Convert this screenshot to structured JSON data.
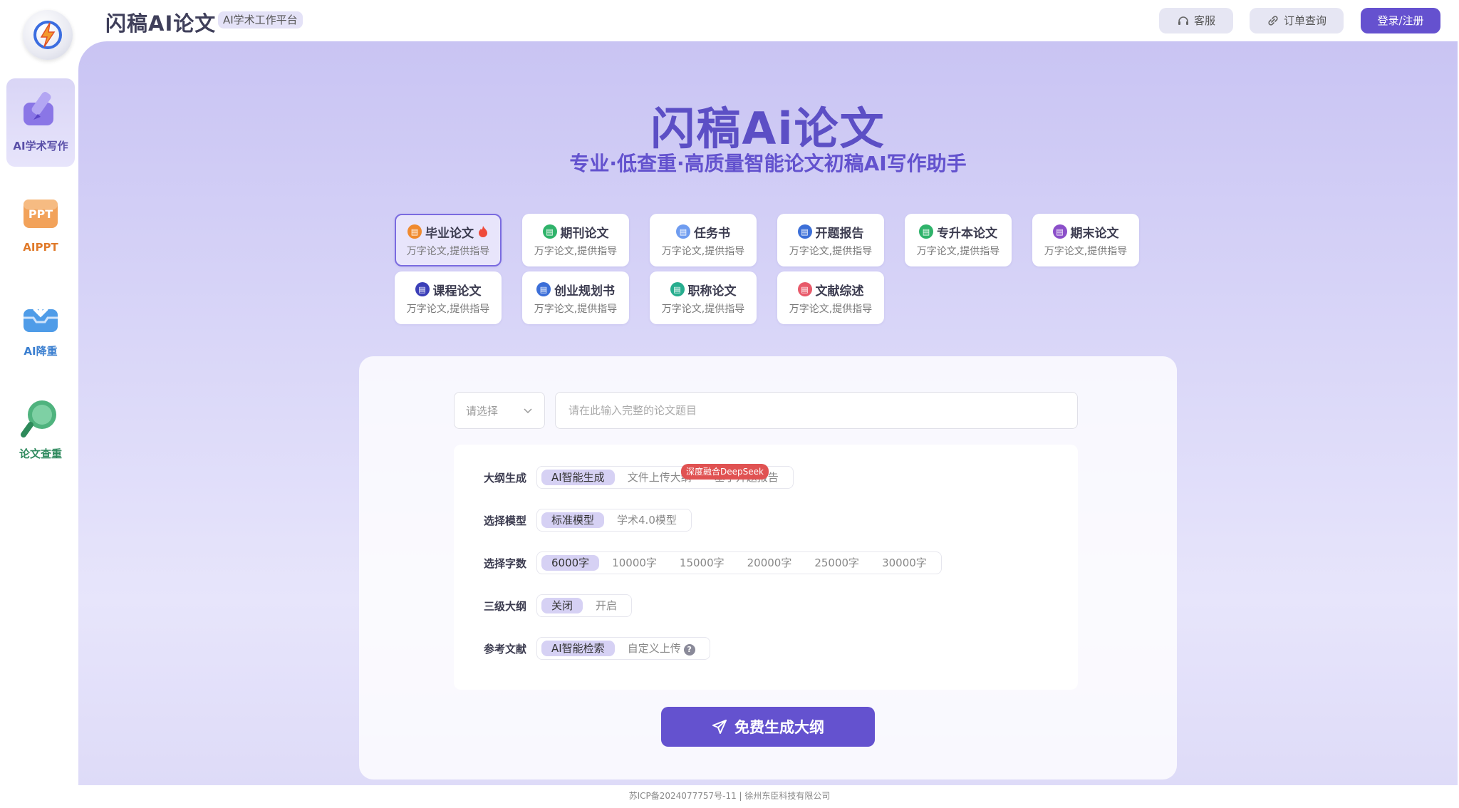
{
  "header": {
    "title": "闪稿AI论文",
    "tag": "AI学术工作平台",
    "service_label": "客服",
    "order_label": "订单查询",
    "login_label": "登录/注册"
  },
  "sidebar": {
    "items": [
      {
        "label": "AI学术写作",
        "icon": "pen-writing-icon",
        "active": true
      },
      {
        "label": "AIPPT",
        "icon": "ppt-icon"
      },
      {
        "label": "AI降重",
        "icon": "inbox-download-icon"
      },
      {
        "label": "论文查重",
        "icon": "search-magnifier-icon"
      }
    ]
  },
  "hero": {
    "title": "闪稿Ai论文",
    "subtitle": "专业·低查重·高质量智能论文初稿AI写作助手"
  },
  "categories": [
    {
      "name": "毕业论文",
      "desc": "万字论文,提供指导",
      "color": "#f08a2e",
      "active": true
    },
    {
      "name": "期刊论文",
      "desc": "万字论文,提供指导",
      "color": "#2fb36a"
    },
    {
      "name": "任务书",
      "desc": "万字论文,提供指导",
      "color": "#6f9cf0"
    },
    {
      "name": "开题报告",
      "desc": "万字论文,提供指导",
      "color": "#3c6fd8"
    },
    {
      "name": "专升本论文",
      "desc": "万字论文,提供指导",
      "color": "#2fb36a"
    },
    {
      "name": "期末论文",
      "desc": "万字论文,提供指导",
      "color": "#8b4fc9"
    },
    {
      "name": "课程论文",
      "desc": "万字论文,提供指导",
      "color": "#3b3fb8"
    },
    {
      "name": "创业规划书",
      "desc": "万字论文,提供指导",
      "color": "#3c6fd8"
    },
    {
      "name": "职称论文",
      "desc": "万字论文,提供指导",
      "color": "#27ad8e"
    },
    {
      "name": "文献综述",
      "desc": "万字论文,提供指导",
      "color": "#e85a6a"
    }
  ],
  "form": {
    "select_placeholder": "请选择",
    "topic_placeholder": "请在此输入完整的论文题目",
    "outline": {
      "label": "大纲生成",
      "options": [
        "AI智能生成",
        "文件上传大纲",
        "基于开题报告"
      ]
    },
    "model": {
      "label": "选择模型",
      "options": [
        "标准模型",
        "学术4.0模型"
      ],
      "badge": "深度融合DeepSeek"
    },
    "words": {
      "label": "选择字数",
      "options": [
        "6000字",
        "10000字",
        "15000字",
        "20000字",
        "25000字",
        "30000字"
      ]
    },
    "level3": {
      "label": "三级大纲",
      "options": [
        "关闭",
        "开启"
      ]
    },
    "refs": {
      "label": "参考文献",
      "options": [
        "AI智能检索",
        "自定义上传"
      ],
      "help": "?"
    },
    "submit_label": "免费生成大纲"
  },
  "footer": "苏ICP备2024077757号-11 | 徐州东臣科技有限公司",
  "colors": {
    "accent": "#6452cf",
    "badge": "#e05252"
  }
}
